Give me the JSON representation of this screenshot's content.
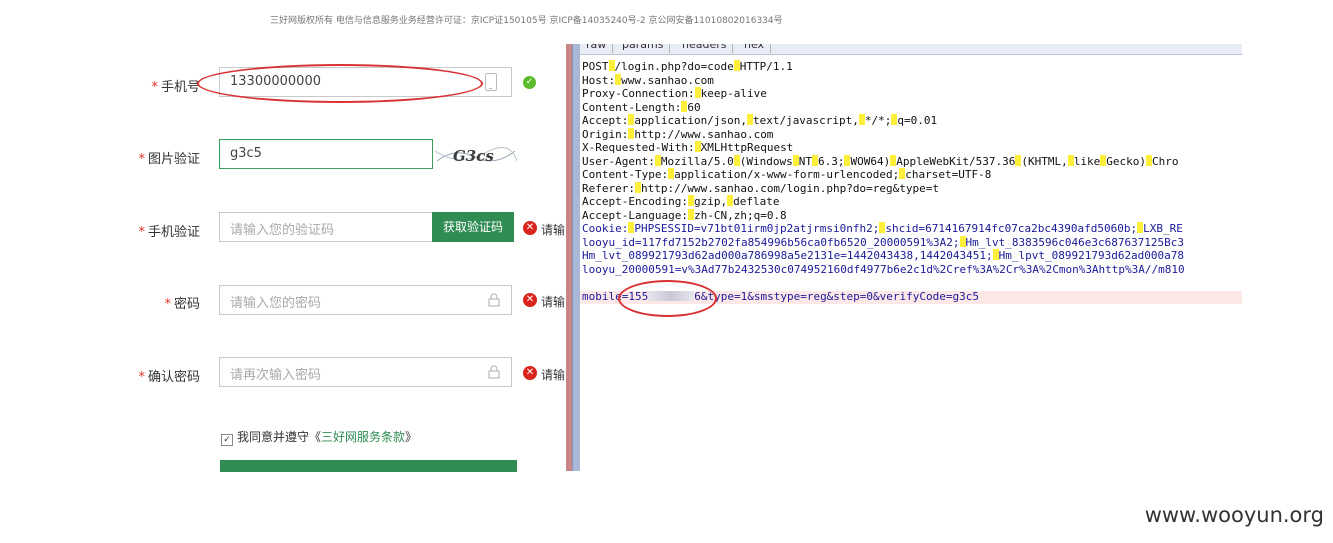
{
  "top_note": "三好网版权所有 电信与信息服务业务经营许可证：京ICP证150105号 京ICP备14035240号-2 京公网安备11010802016334号",
  "form": {
    "phone": {
      "label": "手机号",
      "value": "13300000000"
    },
    "image_captcha": {
      "label": "图片验证",
      "value": "g3c5",
      "captcha_text": "G3cs"
    },
    "sms_code": {
      "label": "手机验证",
      "placeholder": "请输入您的验证码",
      "button": "获取验证码",
      "error": "请输"
    },
    "password": {
      "label": "密码",
      "placeholder": "请输入您的密码",
      "error": "请输"
    },
    "confirm": {
      "label": "确认密码",
      "placeholder": "请再次输入密码",
      "error": "请输"
    },
    "agree": {
      "prefix": "我同意并遵守《",
      "link": "三好网服务条款",
      "suffix": "》"
    },
    "required_mark": "*"
  },
  "tabs": [
    "raw",
    "params",
    "headers",
    "hex"
  ],
  "request_lines": [
    "POST /login.php?do=code HTTP/1.1",
    "Host: www.sanhao.com",
    "Proxy-Connection: keep-alive",
    "Content-Length: 60",
    "Accept: application/json, text/javascript, */*; q=0.01",
    "Origin: http://www.sanhao.com",
    "X-Requested-With: XMLHttpRequest",
    "User-Agent: Mozilla/5.0 (Windows NT 6.3; WOW64) AppleWebKit/537.36 (KHTML, like Gecko) Chro",
    "Content-Type: application/x-www-form-urlencoded; charset=UTF-8",
    "Referer: http://www.sanhao.com/login.php?do=reg&type=t",
    "Accept-Encoding: gzip, deflate",
    "Accept-Language: zh-CN,zh;q=0.8",
    "Cookie: PHPSESSID=v71bt01irm0jp2atjrmsi0nfh2; shcid=6714167914fc07ca2bc4390afd5060b; LXB_RE",
    "looyu_id=117fd7152b2702fa854996b56ca0fb6520_20000591%3A2; Hm_lvt_8383596c046e3c687637125Bc3",
    "Hm_lvt_089921793d62ad000a786998a5e2131e=1442043438,1442043451; Hm_lpvt_089921793d62ad000a78",
    "looyu_20000591=v%3Ad77b2432530c074952160df4977b6e2c1d%2Cref%3A%2Cr%3A%2Cmon%3Ahttp%3A//m810"
  ],
  "body_line": {
    "prefix": "mobile=155",
    "suffix": "6&type=1&smstype=reg&step=0&verifyCode=g3c5"
  },
  "watermark": "www.wooyun.org"
}
